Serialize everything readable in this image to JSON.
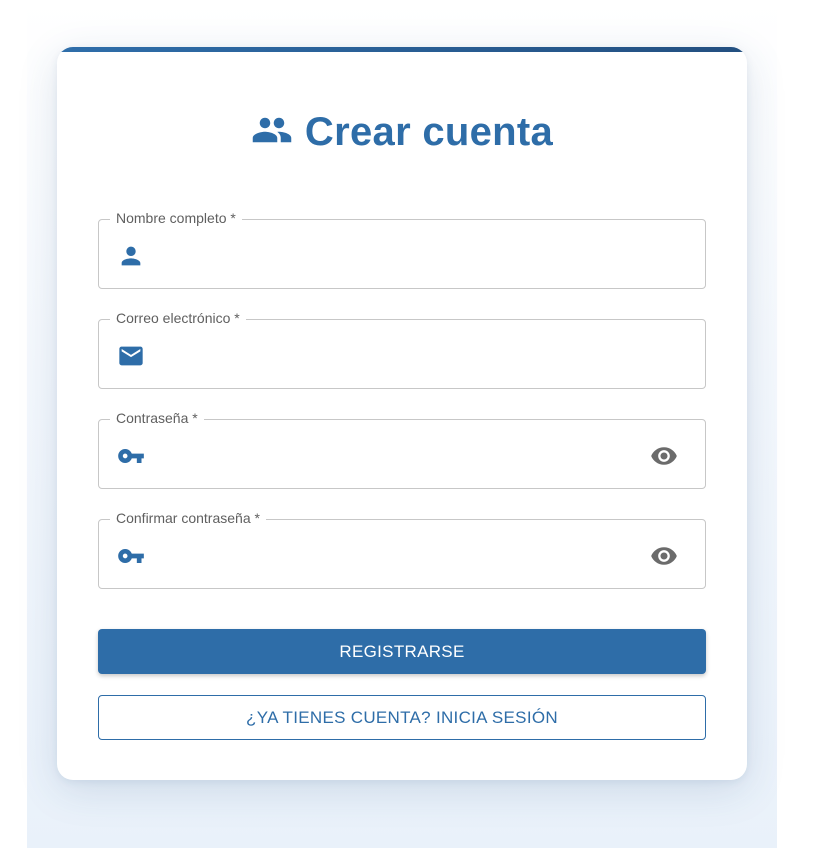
{
  "form": {
    "title": "Crear cuenta",
    "title_icon": "group-icon",
    "fields": [
      {
        "label": "Nombre completo *",
        "value": "",
        "icon": "person-icon",
        "has_visibility_toggle": false
      },
      {
        "label": "Correo electrónico *",
        "value": "",
        "icon": "mail-icon",
        "has_visibility_toggle": false
      },
      {
        "label": "Contraseña *",
        "value": "",
        "icon": "key-icon",
        "has_visibility_toggle": true
      },
      {
        "label": "Confirmar contraseña *",
        "value": "",
        "icon": "key-icon",
        "has_visibility_toggle": true
      }
    ],
    "primary_button": "REGISTRARSE",
    "secondary_button": "¿YA TIENES CUENTA? INICIA SESIÓN"
  },
  "colors": {
    "accent": "#2e6da8",
    "accent_dark": "#234f80",
    "border": "#c7c7c7",
    "label": "#5f5f5f",
    "eye_icon": "#6b6b6b"
  }
}
